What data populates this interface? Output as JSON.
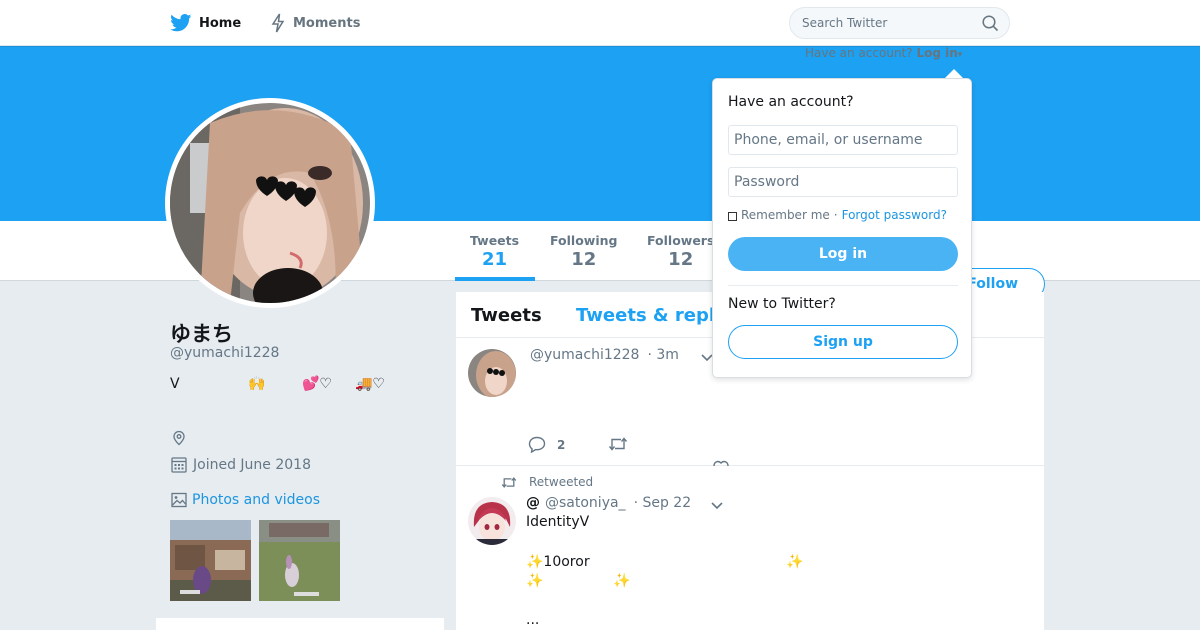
{
  "nav": {
    "home_label": "Home",
    "moments_label": "Moments",
    "search_placeholder": "Search Twitter"
  },
  "login_hint": {
    "text": "Have an account?",
    "link": "Log in"
  },
  "profile": {
    "name": "ゆまち",
    "handle": "@yumachi1228",
    "bio_parts": [
      "V",
      "🙌",
      "💕♡",
      "🚚♡"
    ],
    "joined": "Joined June 2018",
    "photos_link": "Photos and videos"
  },
  "stats": [
    {
      "label": "Tweets",
      "value": "21"
    },
    {
      "label": "Following",
      "value": "12"
    },
    {
      "label": "Followers",
      "value": "12"
    }
  ],
  "follow_button": "Follow",
  "timeline": {
    "tabs": [
      "Tweets",
      "Tweets & replies"
    ],
    "tweet1": {
      "handle": "@yumachi1228",
      "time": "· 3m",
      "reply_count": "2"
    },
    "tweet2": {
      "retweeted_label": "Retweeted",
      "name": "@",
      "handle": "@satoniya_",
      "time": "· Sep 22",
      "line1": "IdentityV",
      "line2": "✨10oror",
      "line2_sparkle": "✨",
      "line3a": "✨",
      "line3b": "✨",
      "line4": "..."
    }
  },
  "login_dropdown": {
    "title": "Have an account?",
    "username_placeholder": "Phone, email, or username",
    "password_placeholder": "Password",
    "remember": "Remember me",
    "separator": "·",
    "forgot": "Forgot password?",
    "login_button": "Log in",
    "new_label": "New to Twitter?",
    "signup_button": "Sign up"
  },
  "colors": {
    "brand": "#1da1f2",
    "link": "#1b95e0",
    "muted": "#657786"
  }
}
